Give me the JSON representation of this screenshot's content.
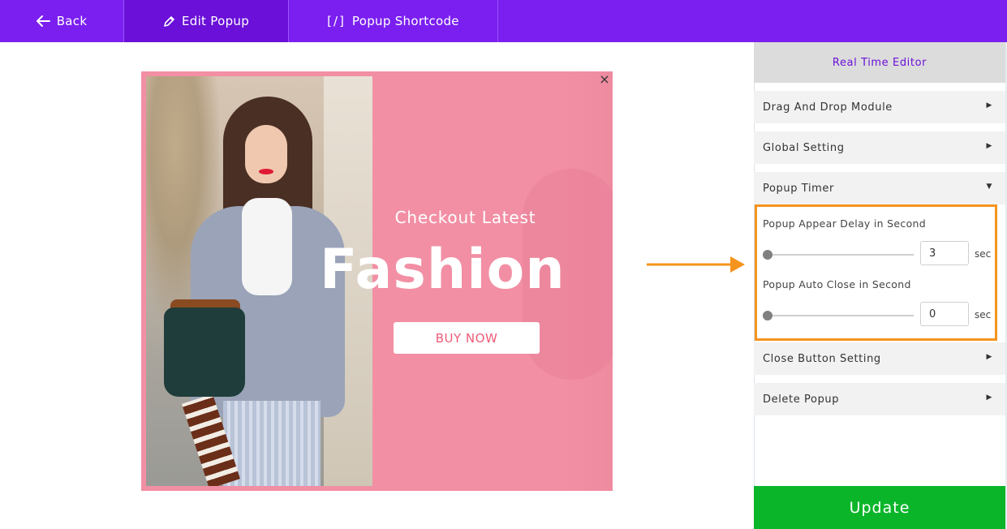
{
  "topbar": {
    "back_label": "Back",
    "edit_label": "Edit Popup",
    "shortcode_glyph": "[/]",
    "shortcode_label": "Popup Shortcode"
  },
  "popup": {
    "subtitle": "Checkout Latest",
    "title": "Fashion",
    "button_label": "BUY NOW",
    "close_glyph": "×",
    "accent_color": "#f28fa4"
  },
  "panel": {
    "header": "Real Time Editor",
    "sections": [
      {
        "label": "Drag And Drop Module",
        "state": "collapsed"
      },
      {
        "label": "Global Setting",
        "state": "collapsed"
      },
      {
        "label": "Popup Timer",
        "state": "expanded"
      },
      {
        "label": "Close Button Setting",
        "state": "collapsed"
      },
      {
        "label": "Delete Popup",
        "state": "collapsed"
      }
    ],
    "carets": {
      "collapsed": "▶",
      "expanded": "▼"
    },
    "timer": {
      "appear_label": "Popup Appear Delay in Second",
      "appear_value": "3",
      "close_label": "Popup Auto Close in Second",
      "close_value": "0",
      "unit": "sec"
    },
    "update_label": "Update"
  },
  "colors": {
    "topbar": "#7a1ff0",
    "highlight": "#f5941d",
    "update": "#0ab52a"
  }
}
